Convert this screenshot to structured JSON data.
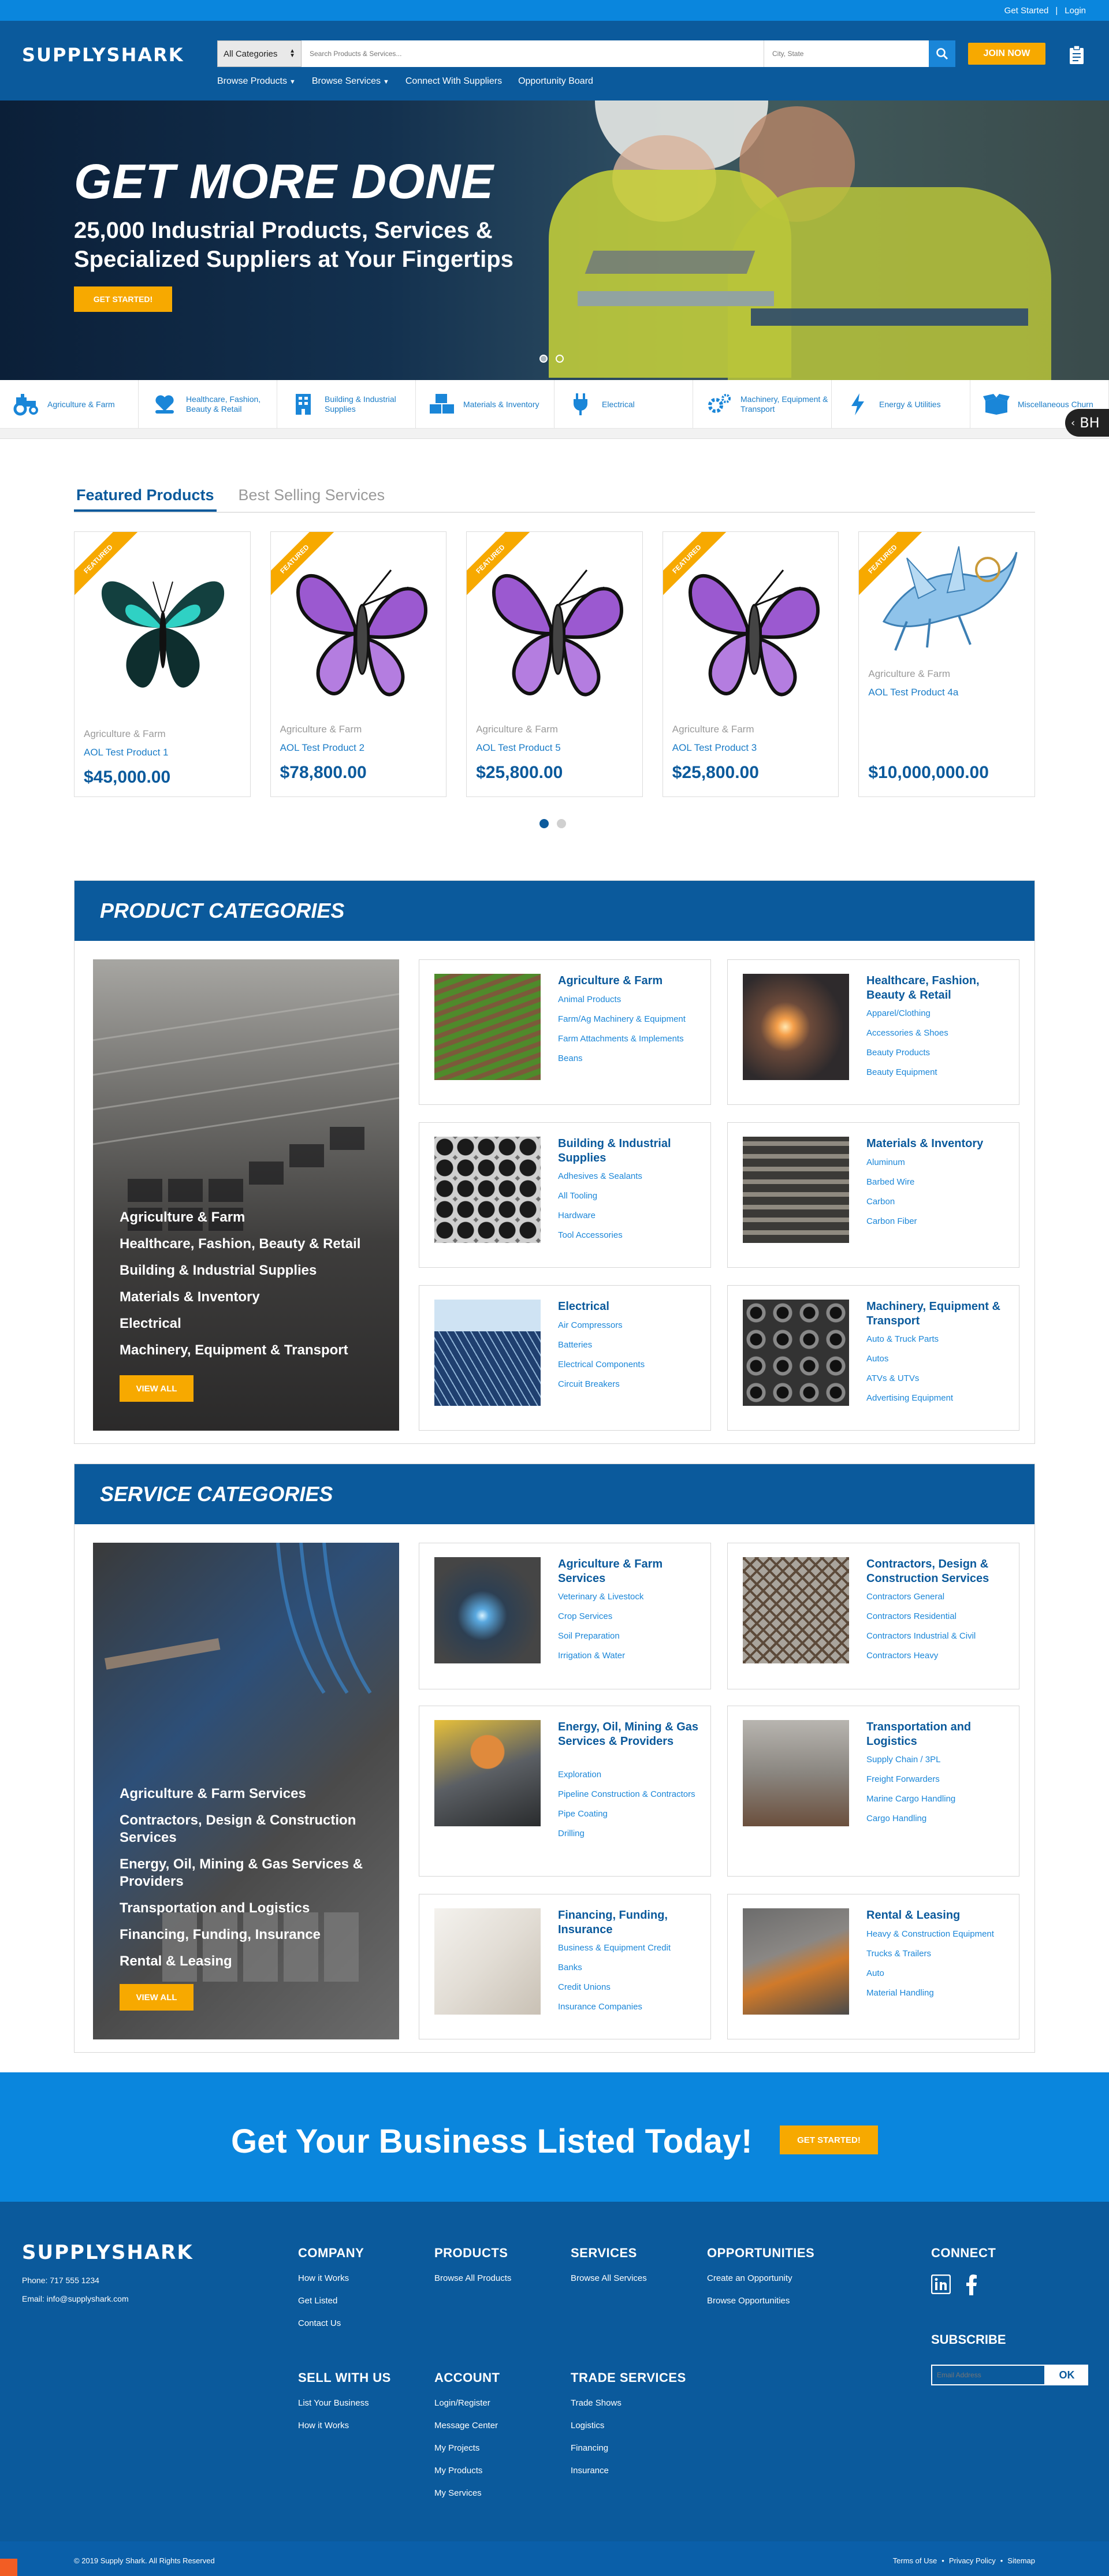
{
  "topbar": {
    "get_started": "Get Started",
    "separator": "|",
    "login": "Login"
  },
  "header": {
    "logo": "SUPPLYSHARK",
    "category_select": "All Categories",
    "search_placeholder": "Search Products & Services...",
    "city_placeholder": "City, State",
    "join_label": "JOIN NOW",
    "nav": [
      {
        "label": "Browse Products",
        "has_dropdown": true
      },
      {
        "label": "Browse Services",
        "has_dropdown": true
      },
      {
        "label": "Connect With Suppliers",
        "has_dropdown": false
      },
      {
        "label": "Opportunity Board",
        "has_dropdown": false
      }
    ]
  },
  "hero": {
    "title": "GET MORE DONE",
    "subtitle": "25,000 Industrial Products, Services & Specialized Suppliers at Your Fingertips",
    "button": "GET STARTED!"
  },
  "category_strip": [
    {
      "label": "Agriculture & Farm",
      "icon": "tractor-icon"
    },
    {
      "label": "Healthcare, Fashion, Beauty & Retail",
      "icon": "heart-hand-icon"
    },
    {
      "label": "Building & Industrial Supplies",
      "icon": "building-icon"
    },
    {
      "label": "Materials & Inventory",
      "icon": "boxes-icon"
    },
    {
      "label": "Electrical",
      "icon": "plug-icon"
    },
    {
      "label": "Machinery, Equipment & Transport",
      "icon": "gears-icon"
    },
    {
      "label": "Energy & Utilities",
      "icon": "lightning-icon"
    },
    {
      "label": "Miscellaneous Churn",
      "icon": "open-box-icon"
    }
  ],
  "badge": {
    "text": "BH"
  },
  "featured": {
    "tabs": [
      "Featured Products",
      "Best Selling Services"
    ],
    "ribbon": "FEATURED",
    "products": [
      {
        "category": "Agriculture & Farm",
        "name": "AOL Test Product 1",
        "price": "$45,000.00",
        "featured": true,
        "image": "teal-butterfly"
      },
      {
        "category": "Agriculture & Farm",
        "name": "AOL Test Product 2",
        "price": "$78,800.00",
        "featured": true,
        "image": "purple-butterfly"
      },
      {
        "category": "Agriculture & Farm",
        "name": "AOL Test Product 5",
        "price": "$25,800.00",
        "featured": true,
        "image": "purple-butterfly"
      },
      {
        "category": "Agriculture & Farm",
        "name": "AOL Test Product 3",
        "price": "$25,800.00",
        "featured": true,
        "image": "purple-butterfly"
      },
      {
        "category": "Agriculture & Farm",
        "name": "AOL Test Product 4a",
        "price": "$10,000,000.00",
        "featured": true,
        "image": "blue-dragon"
      }
    ]
  },
  "product_categories": {
    "title": "PRODUCT CATEGORIES",
    "feature_list": [
      "Agriculture & Farm",
      "Healthcare, Fashion, Beauty & Retail",
      "Building & Industrial Supplies",
      "Materials & Inventory",
      "Electrical",
      "Machinery, Equipment & Transport"
    ],
    "view_all": "VIEW ALL",
    "cards": [
      {
        "title": "Agriculture & Farm",
        "links": [
          "Animal Products",
          "Farm/Ag Machinery & Equipment",
          "Farm Attachments & Implements",
          "Beans"
        ]
      },
      {
        "title": "Healthcare, Fashion, Beauty & Retail",
        "links": [
          "Apparel/Clothing",
          "Accessories & Shoes",
          "Beauty Products",
          "Beauty Equipment"
        ]
      },
      {
        "title": "Building & Industrial Supplies",
        "links": [
          "Adhesives & Sealants",
          "All Tooling",
          "Hardware",
          "Tool Accessories"
        ]
      },
      {
        "title": "Materials & Inventory",
        "links": [
          "Aluminum",
          "Barbed Wire",
          "Carbon",
          "Carbon Fiber"
        ]
      },
      {
        "title": "Electrical",
        "links": [
          "Air Compressors",
          "Batteries",
          "Electrical Components",
          "Circuit Breakers"
        ]
      },
      {
        "title": "Machinery, Equipment & Transport",
        "links": [
          "Auto & Truck Parts",
          "Autos",
          "ATVs & UTVs",
          "Advertising Equipment"
        ]
      }
    ]
  },
  "service_categories": {
    "title": "SERVICE CATEGORIES",
    "feature_list": [
      "Agriculture & Farm Services",
      "Contractors, Design & Construction Services",
      "Energy, Oil, Mining & Gas Services & Providers",
      "Transportation and Logistics",
      "Financing, Funding, Insurance",
      "Rental & Leasing"
    ],
    "view_all": "VIEW ALL",
    "cards": [
      {
        "title": "Agriculture & Farm Services",
        "links": [
          "Veterinary & Livestock",
          "Crop Services",
          "Soil Preparation",
          "Irrigation & Water"
        ]
      },
      {
        "title": "Contractors, Design & Construction Services",
        "links": [
          "Contractors General",
          "Contractors Residential",
          "Contractors Industrial & Civil",
          "Contractors Heavy"
        ]
      },
      {
        "title": "Energy, Oil, Mining & Gas Services & Providers",
        "links": [
          "Exploration",
          "Pipeline Construction & Contractors",
          "Pipe Coating",
          "Drilling"
        ]
      },
      {
        "title": "Transportation and Logistics",
        "links": [
          "Supply Chain / 3PL",
          "Freight Forwarders",
          "Marine Cargo Handling",
          "Cargo Handling"
        ]
      },
      {
        "title": "Financing, Funding, Insurance",
        "links": [
          "Business & Equipment Credit",
          "Banks",
          "Credit Unions",
          "Insurance Companies"
        ]
      },
      {
        "title": "Rental & Leasing",
        "links": [
          "Heavy & Construction Equipment",
          "Trucks & Trailers",
          "Auto",
          "Material Handling"
        ]
      }
    ]
  },
  "cta": {
    "text": "Get Your Business Listed Today!",
    "button": "GET STARTED!"
  },
  "footer": {
    "logo": "SUPPLYSHARK",
    "phone": "Phone: 717 555 1234",
    "email": "Email: info@supplyshark.com",
    "company": {
      "title": "COMPANY",
      "links": [
        "How it Works",
        "Get Listed",
        "Contact Us"
      ]
    },
    "products": {
      "title": "PRODUCTS",
      "links": [
        "Browse All Products"
      ]
    },
    "services": {
      "title": "SERVICES",
      "links": [
        "Browse All Services"
      ]
    },
    "opportunities": {
      "title": "OPPORTUNITIES",
      "links": [
        "Create an Opportunity",
        "Browse Opportunities"
      ]
    },
    "sell": {
      "title": "SELL WITH US",
      "links": [
        "List Your Business",
        "How it Works"
      ]
    },
    "account": {
      "title": "ACCOUNT",
      "links": [
        "Login/Register",
        "Message Center",
        "My Projects",
        "My Products",
        "My Services"
      ]
    },
    "trade": {
      "title": "TRADE SERVICES",
      "links": [
        "Trade Shows",
        "Logistics",
        "Financing",
        "Insurance"
      ]
    },
    "connect_title": "CONNECT",
    "subscribe_title": "SUBSCRIBE",
    "email_placeholder": "Email Address",
    "ok": "OK"
  },
  "bottombar": {
    "copyright": "© 2019 Supply Shark. All Rights Reserved",
    "legal": [
      "Terms of Use",
      "Privacy Policy",
      "Sitemap"
    ],
    "bullet": "•"
  },
  "colors": {
    "primary": "#0b5a9c",
    "accent": "#f7a900",
    "bright": "#0a86dd",
    "link": "#1a86d8"
  }
}
